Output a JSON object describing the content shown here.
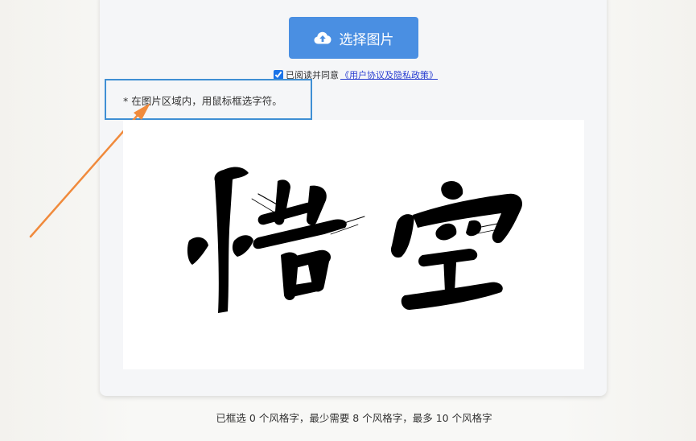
{
  "upload": {
    "label": "选择图片",
    "icon": "cloud-upload-icon"
  },
  "agreement": {
    "checked": true,
    "text": "已阅读并同意",
    "link": "《用户协议及隐私政策》"
  },
  "hint": {
    "text": "* 在图片区域内，用鼠标框选字符。"
  },
  "image": {
    "characters": "悟空"
  },
  "status": {
    "text": "已框选 0 个风格字，最少需要 8 个风格字，最多 10 个风格字"
  },
  "colors": {
    "primary": "#4a8fe2",
    "hint_border": "#3f8fd4",
    "arrow": "#f08a3c",
    "link": "#2a3fd1"
  }
}
